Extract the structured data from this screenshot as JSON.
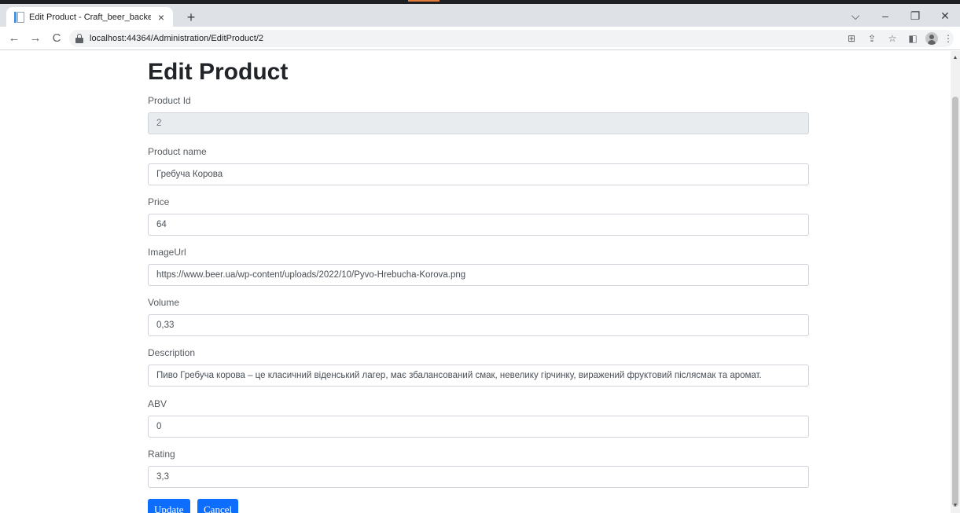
{
  "browser": {
    "tab_title": "Edit Product - Craft_beer_backe",
    "tab_close": "×",
    "new_tab": "+",
    "window_controls": {
      "dropdown": "⌵",
      "minimize": "–",
      "restore": "❐",
      "close": "✕"
    },
    "nav": {
      "back": "←",
      "forward": "→",
      "reload": "C"
    },
    "url": "localhost:44364/Administration/EditProduct/2",
    "omnibox_icons": {
      "translate": "⊞",
      "share": "⇪",
      "bookmark": "☆",
      "sidepanel": "◧",
      "menu": "⋮"
    }
  },
  "page": {
    "title": "Edit Product",
    "fields": {
      "product_id": {
        "label": "Product Id",
        "value": "2"
      },
      "product_name": {
        "label": "Product name",
        "value": "Гребуча Корова"
      },
      "price": {
        "label": "Price",
        "value": "64"
      },
      "image_url": {
        "label": "ImageUrl",
        "value": "https://www.beer.ua/wp-content/uploads/2022/10/Pyvo-Hrebucha-Korova.png"
      },
      "volume": {
        "label": "Volume",
        "value": "0,33"
      },
      "description": {
        "label": "Description",
        "value": "Пиво Гребуча корова – це класичний віденський лагер, має збалансований смак, невелику гірчинку, виражений фруктовий післясмак та аромат."
      },
      "abv": {
        "label": "ABV",
        "value": "0"
      },
      "rating": {
        "label": "Rating",
        "value": "3,3"
      }
    },
    "buttons": {
      "update": "Update",
      "cancel": "Cancel"
    }
  },
  "scrollbar": {
    "up": "▲",
    "down": "▼"
  },
  "colors": {
    "primary": "#0d6efd",
    "readonly_bg": "#e9ecef",
    "border": "#ced4da",
    "tabstrip": "#dee1e6"
  }
}
